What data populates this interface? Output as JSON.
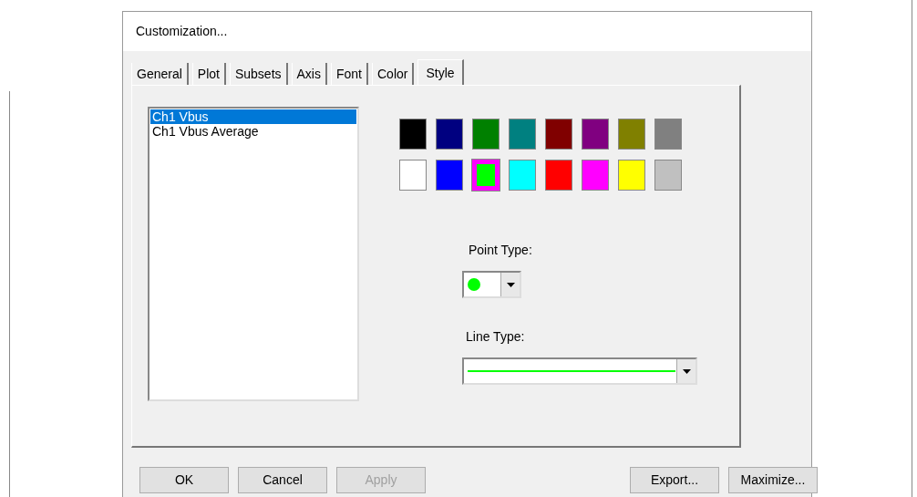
{
  "window": {
    "title": "Customization..."
  },
  "tabs": [
    {
      "label": "General",
      "selected": false
    },
    {
      "label": "Plot",
      "selected": false
    },
    {
      "label": "Subsets",
      "selected": false
    },
    {
      "label": "Axis",
      "selected": false
    },
    {
      "label": "Font",
      "selected": false
    },
    {
      "label": "Color",
      "selected": false
    },
    {
      "label": "Style",
      "selected": true
    }
  ],
  "series_list": [
    {
      "label": "Ch1 Vbus",
      "selected": true
    },
    {
      "label": "Ch1 Vbus Average",
      "selected": false
    }
  ],
  "palette": [
    {
      "color": "#000000",
      "selected": false
    },
    {
      "color": "#000080",
      "selected": false
    },
    {
      "color": "#008000",
      "selected": false
    },
    {
      "color": "#008080",
      "selected": false
    },
    {
      "color": "#800000",
      "selected": false
    },
    {
      "color": "#800080",
      "selected": false
    },
    {
      "color": "#808000",
      "selected": false
    },
    {
      "color": "#808080",
      "selected": false
    },
    {
      "color": "#ffffff",
      "selected": false
    },
    {
      "color": "#0000ff",
      "selected": false
    },
    {
      "color": "#00ff00",
      "selected": true
    },
    {
      "color": "#00ffff",
      "selected": false
    },
    {
      "color": "#ff0000",
      "selected": false
    },
    {
      "color": "#ff00ff",
      "selected": false
    },
    {
      "color": "#ffff00",
      "selected": false
    },
    {
      "color": "#c0c0c0",
      "selected": false
    }
  ],
  "point_type": {
    "label": "Point Type:"
  },
  "line_type": {
    "label": "Line Type:"
  },
  "buttons_left": [
    {
      "label": "OK",
      "disabled": false
    },
    {
      "label": "Cancel",
      "disabled": false
    },
    {
      "label": "Apply",
      "disabled": true
    }
  ],
  "buttons_right": [
    {
      "label": "Export...",
      "disabled": false
    },
    {
      "label": "Maximize...",
      "disabled": false
    }
  ]
}
